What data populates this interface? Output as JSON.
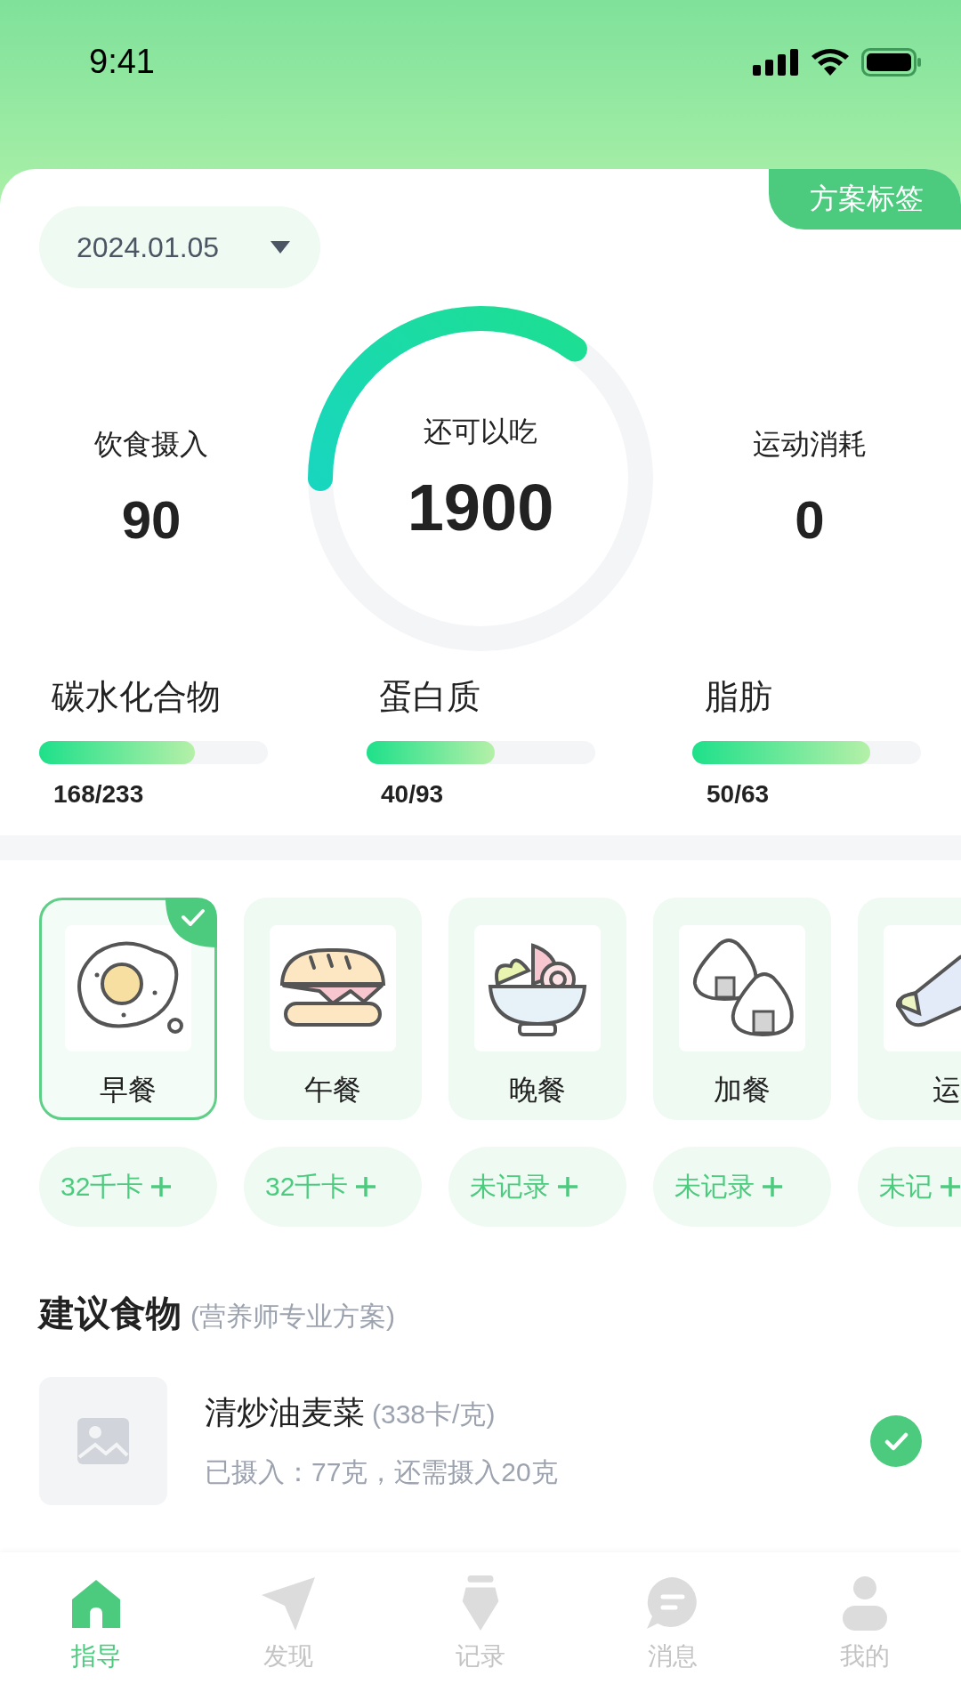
{
  "status_bar": {
    "time": "9:41"
  },
  "plan_tag": "方案标签",
  "date_picker": {
    "value": "2024.01.05"
  },
  "summary": {
    "intake": {
      "label": "饮食摄入",
      "value": "90"
    },
    "remaining": {
      "label": "还可以吃",
      "value": "1900"
    },
    "exercise": {
      "label": "运动消耗",
      "value": "0"
    }
  },
  "macros": [
    {
      "name": "碳水化合物",
      "level": 0.68,
      "reading": "168/233"
    },
    {
      "name": "蛋白质",
      "level": 0.56,
      "reading": "40/93"
    },
    {
      "name": "脂肪",
      "level": 0.78,
      "reading": "50/63"
    }
  ],
  "meals": [
    {
      "kind": "egg",
      "label": "早餐",
      "selected": true,
      "kcal": "32千卡"
    },
    {
      "kind": "burger",
      "label": "午餐",
      "selected": false,
      "kcal": "32千卡"
    },
    {
      "kind": "bowl",
      "label": "晚餐",
      "selected": false,
      "kcal": "未记录"
    },
    {
      "kind": "onigiri",
      "label": "加餐",
      "selected": false,
      "kcal": "未记录"
    },
    {
      "kind": "shoe",
      "label": "运",
      "selected": false,
      "kcal": "未记"
    }
  ],
  "suggested": {
    "title": "建议食物",
    "subtitle": "(营养师专业方案)",
    "items": [
      {
        "name": "清炒油麦菜",
        "calories": "(338卡/克)",
        "progress": "已摄入：77克，还需摄入20克",
        "checked": true
      }
    ]
  },
  "tab_bar": [
    {
      "kind": "home",
      "label": "指导",
      "selected": true
    },
    {
      "kind": "plane",
      "label": "发现",
      "selected": false
    },
    {
      "kind": "pen",
      "label": "记录",
      "selected": false
    },
    {
      "kind": "chat",
      "label": "消息",
      "selected": false
    },
    {
      "kind": "person",
      "label": "我的",
      "selected": false
    }
  ]
}
